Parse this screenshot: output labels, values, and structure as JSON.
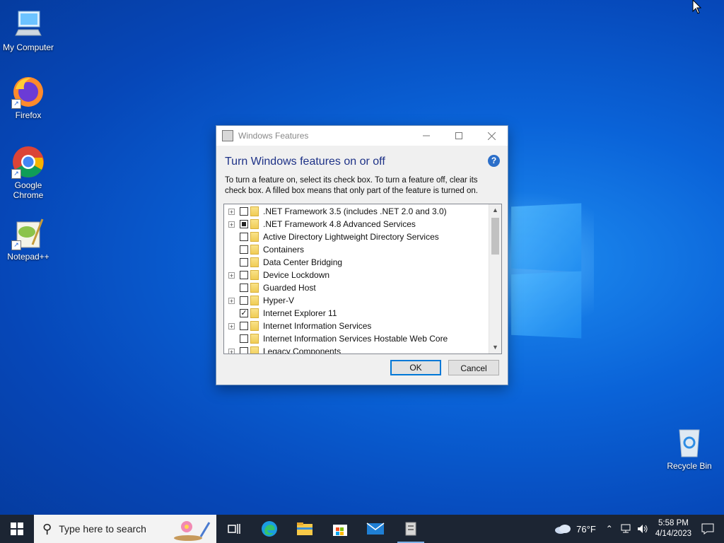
{
  "desktop": {
    "icons": [
      {
        "label": "My Computer"
      },
      {
        "label": "Firefox"
      },
      {
        "label": "Google Chrome"
      },
      {
        "label": "Notepad++"
      },
      {
        "label": "Recycle Bin"
      }
    ]
  },
  "dialog": {
    "title": "Windows Features",
    "heading": "Turn Windows features on or off",
    "description": "To turn a feature on, select its check box. To turn a feature off, clear its check box. A filled box means that only part of the feature is turned on.",
    "features": [
      {
        "label": ".NET Framework 3.5 (includes .NET 2.0 and 3.0)",
        "expandable": true,
        "state": "unchecked"
      },
      {
        "label": ".NET Framework 4.8 Advanced Services",
        "expandable": true,
        "state": "partial"
      },
      {
        "label": "Active Directory Lightweight Directory Services",
        "expandable": false,
        "state": "unchecked"
      },
      {
        "label": "Containers",
        "expandable": false,
        "state": "unchecked"
      },
      {
        "label": "Data Center Bridging",
        "expandable": false,
        "state": "unchecked"
      },
      {
        "label": "Device Lockdown",
        "expandable": true,
        "state": "unchecked"
      },
      {
        "label": "Guarded Host",
        "expandable": false,
        "state": "unchecked"
      },
      {
        "label": "Hyper-V",
        "expandable": true,
        "state": "unchecked"
      },
      {
        "label": "Internet Explorer 11",
        "expandable": false,
        "state": "checked"
      },
      {
        "label": "Internet Information Services",
        "expandable": true,
        "state": "unchecked"
      },
      {
        "label": "Internet Information Services Hostable Web Core",
        "expandable": false,
        "state": "unchecked"
      },
      {
        "label": "Legacy Components",
        "expandable": true,
        "state": "unchecked"
      }
    ],
    "ok_label": "OK",
    "cancel_label": "Cancel"
  },
  "taskbar": {
    "search_placeholder": "Type here to search",
    "weather": "76°F",
    "time": "5:58 PM",
    "date": "4/14/2023"
  },
  "colors": {
    "accent": "#0078d7",
    "heading": "#1e3287",
    "taskbar": "#1c2533"
  }
}
